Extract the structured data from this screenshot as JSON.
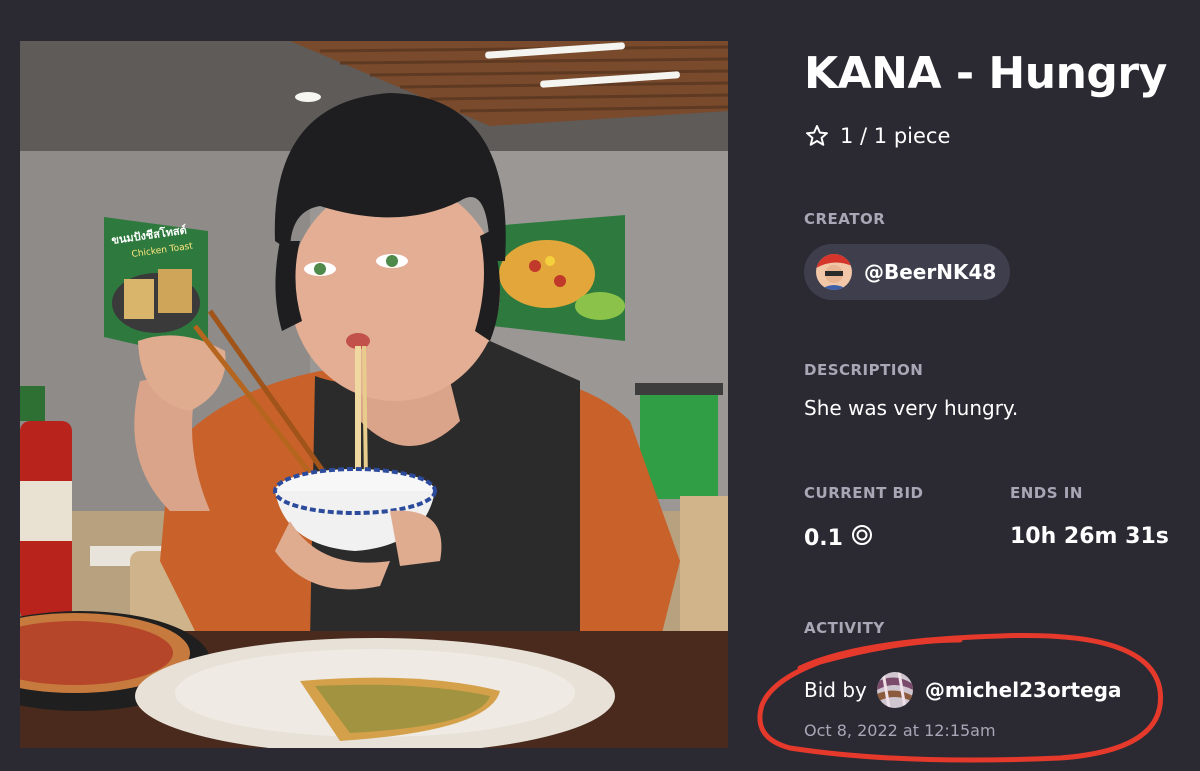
{
  "artwork": {
    "icon": "artwork-image",
    "poster_left": {
      "line1": "ขนมปังชีสโทสต์",
      "line2": "Chicken Toast"
    }
  },
  "item": {
    "title": "KANA - Hungry",
    "edition": "1 / 1 piece",
    "star_icon": "star-outline-icon"
  },
  "creator": {
    "label": "CREATOR",
    "handle": "@BeerNK48"
  },
  "description": {
    "label": "DESCRIPTION",
    "text": "She was very hungry."
  },
  "auction": {
    "current_bid_label": "CURRENT BID",
    "current_bid_value": "0.1",
    "currency_icon": "tez-currency-icon",
    "ends_label": "ENDS IN",
    "ends_value": "10h 26m 31s"
  },
  "activity": {
    "label": "ACTIVITY",
    "prefix": "Bid by",
    "bidder": "@michel23ortega",
    "time": "Oct 8, 2022 at 12:15am"
  },
  "colors": {
    "background": "#2b2a33",
    "pill": "#3f3e4d",
    "muted_text": "#a9a7b6",
    "annotation_red": "#e5392c"
  }
}
